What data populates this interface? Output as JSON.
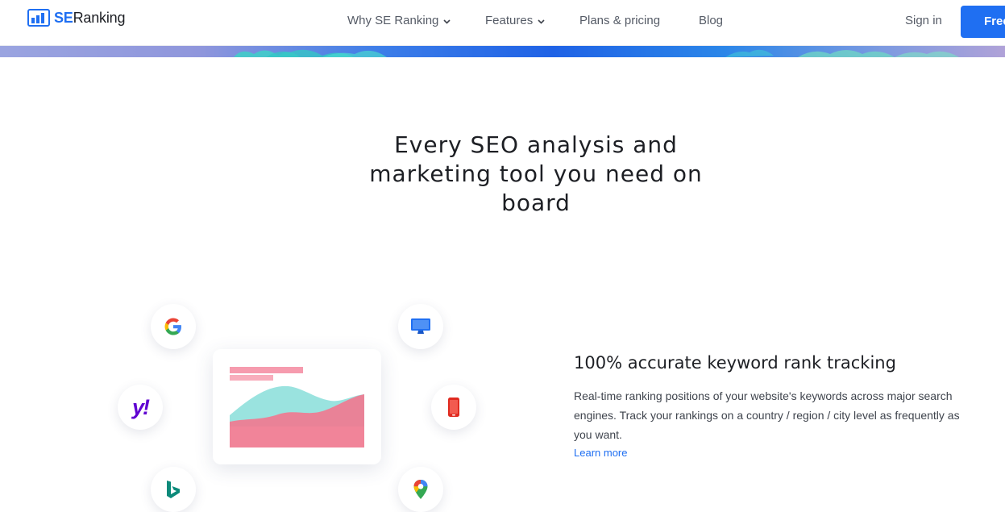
{
  "header": {
    "logo": {
      "brand_se": "SE",
      "brand_rest": "Ranking",
      "icon": "bar-chart-logo-icon"
    },
    "nav": [
      {
        "label": "Why SE Ranking",
        "has_dropdown": true
      },
      {
        "label": "Features",
        "has_dropdown": true
      },
      {
        "label": "Plans & pricing",
        "has_dropdown": false
      },
      {
        "label": "Blog",
        "has_dropdown": false
      }
    ],
    "signin_label": "Sign in",
    "cta_label": "Free"
  },
  "hero": {
    "headline_lines": [
      "Every SEO analysis and",
      "marketing tool you need on",
      "board"
    ]
  },
  "illustration": {
    "icons": [
      "google-icon",
      "desktop-icon",
      "yahoo-icon",
      "mobile-icon",
      "bing-icon",
      "maps-pin-icon"
    ],
    "yahoo_text": "y!"
  },
  "feature": {
    "title": "100% accurate keyword rank tracking",
    "description": "Real-time ranking positions of your website's keywords across major search engines. Track your rankings on a country / region / city level as frequently as you want.",
    "link_label": "Learn more"
  },
  "colors": {
    "accent": "#1f6ff2",
    "text": "#1d1f24",
    "chart_pink": "#f07a90",
    "chart_teal": "#8fe0dc"
  }
}
